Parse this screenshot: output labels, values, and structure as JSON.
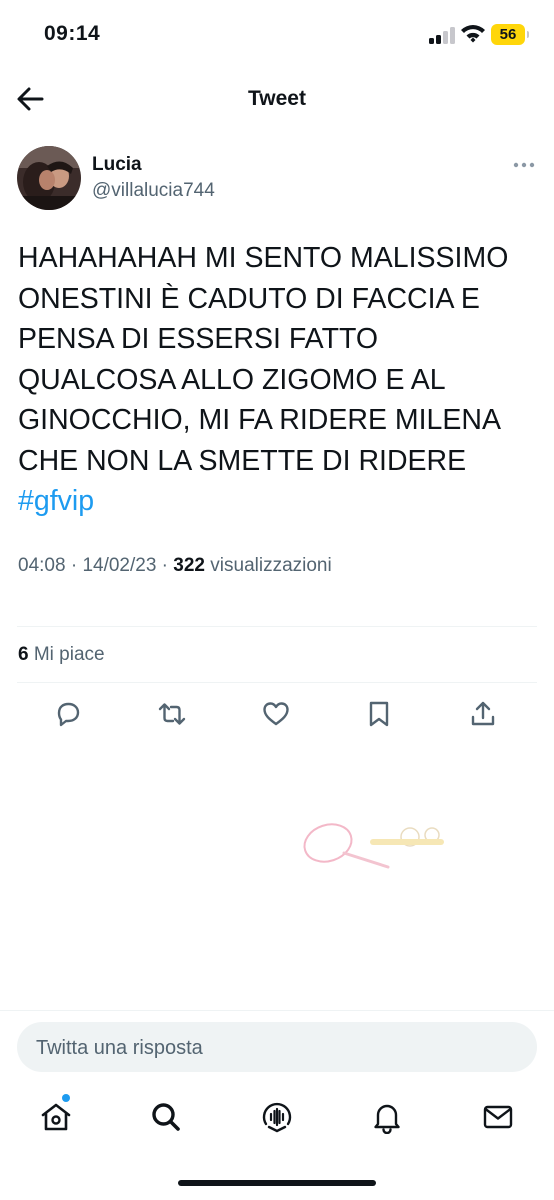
{
  "status_bar": {
    "time": "09:14",
    "battery": "56"
  },
  "header": {
    "title": "Tweet"
  },
  "author": {
    "name": "Lucia",
    "handle": "@villalucia744"
  },
  "tweet": {
    "text": "HAHAHAHAH MI SENTO MALISSIMO\nONESTINI È CADUTO DI FACCIA E\nPENSA DI ESSERSI FATTO\nQUALCOSA ALLO ZIGOMO E AL\nGINOCCHIO, MI FA RIDERE MILENA\nCHE NON LA SMETTE DI RIDERE",
    "hashtag": "#gfvip",
    "time": "04:08",
    "date": "14/02/23",
    "views_count": "322",
    "views_label": "visualizzazioni"
  },
  "engagement": {
    "likes_count": "6",
    "likes_label": "Mi piace"
  },
  "actions": [
    "reply-icon",
    "retweet-icon",
    "like-icon",
    "bookmark-icon",
    "share-icon"
  ],
  "reply": {
    "placeholder": "Twitta una risposta"
  },
  "tabbar": [
    "home-icon",
    "search-icon",
    "spaces-icon",
    "notifications-icon",
    "messages-icon"
  ],
  "colors": {
    "accent": "#1d9bf0",
    "secondary_text": "#536471",
    "battery": "#ffd60a"
  }
}
